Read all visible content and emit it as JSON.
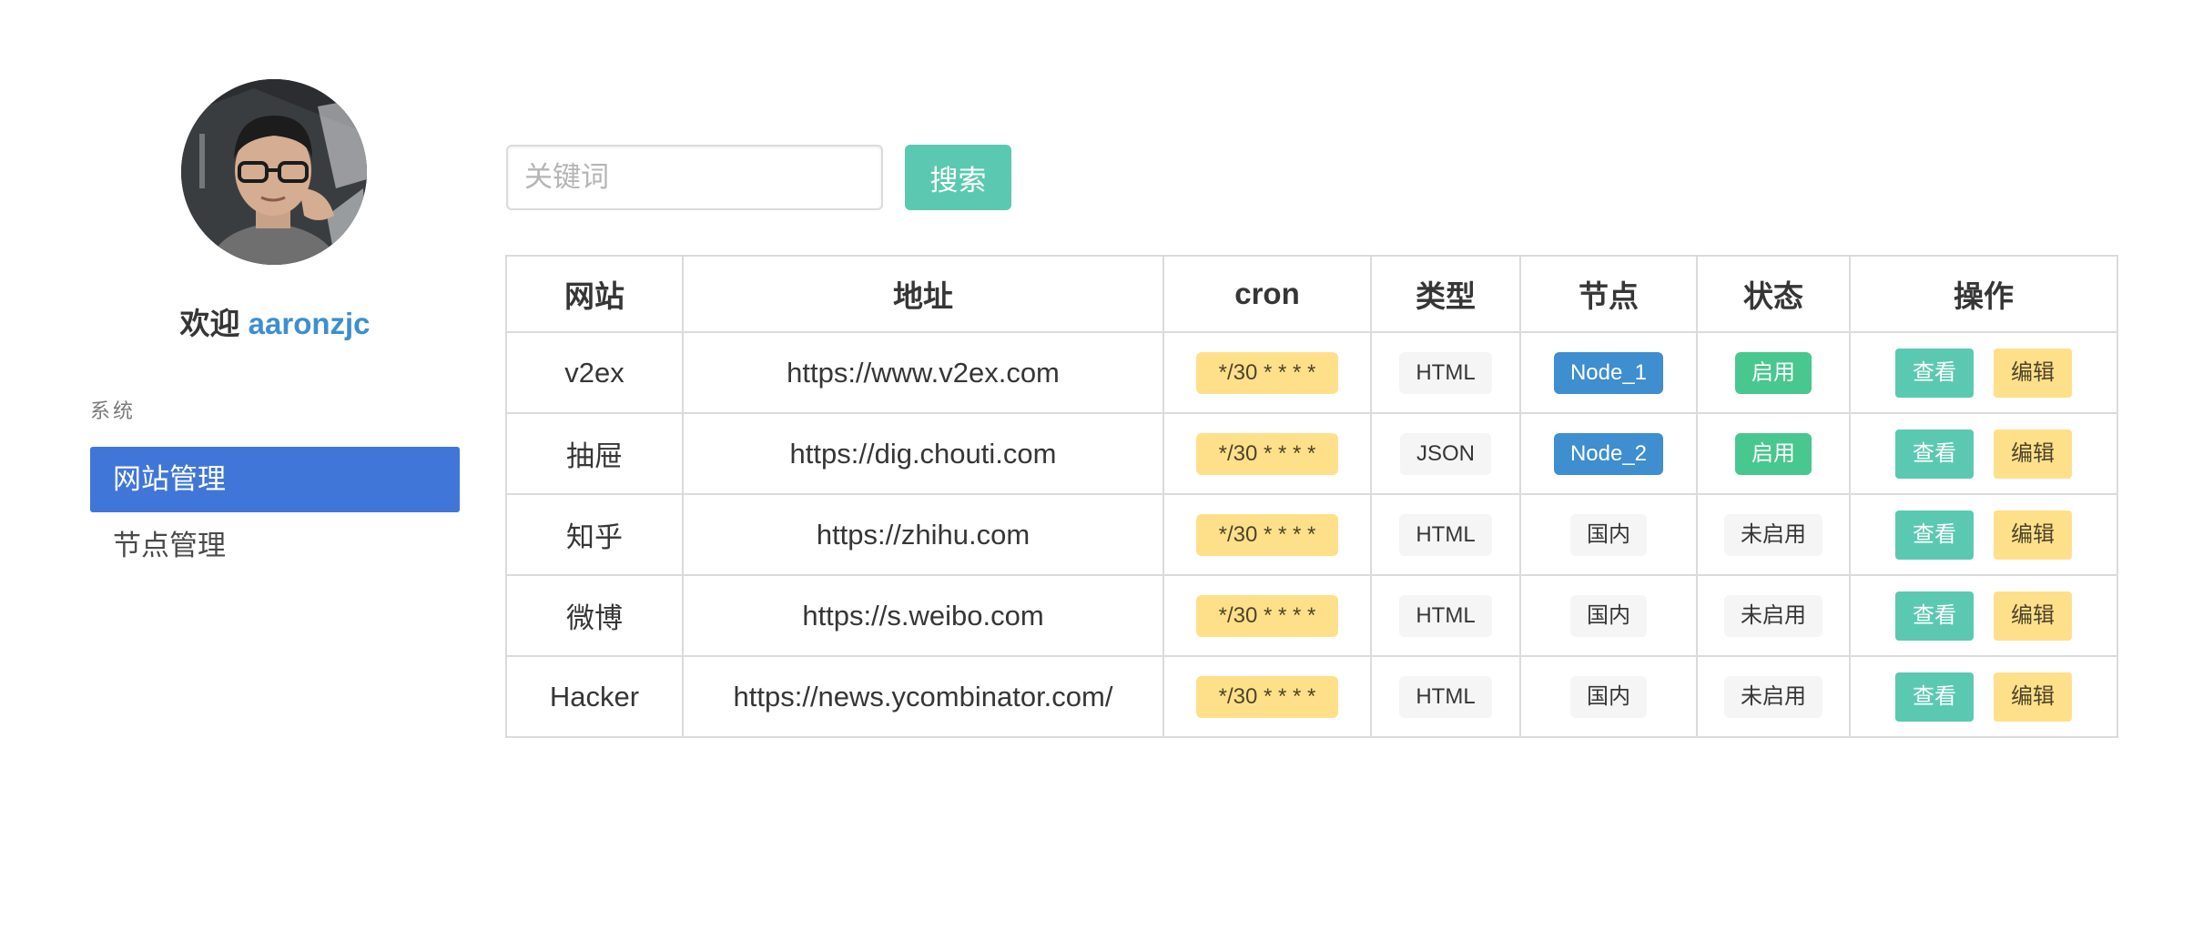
{
  "sidebar": {
    "welcome_prefix": "欢迎",
    "username": "aaronzjc",
    "menu_label": "系统",
    "items": [
      {
        "label": "网站管理",
        "active": true
      },
      {
        "label": "节点管理",
        "active": false
      }
    ]
  },
  "search": {
    "placeholder": "关键词",
    "value": "",
    "button_label": "搜索"
  },
  "table": {
    "headers": {
      "site": "网站",
      "url": "地址",
      "cron": "cron",
      "type": "类型",
      "node": "节点",
      "status": "状态",
      "ops": "操作"
    },
    "rows": [
      {
        "site": "v2ex",
        "url": "https://www.v2ex.com",
        "cron": "*/30 * * * *",
        "type": "HTML",
        "node": "Node_1",
        "status": "启用",
        "view": "查看",
        "edit": "编辑"
      },
      {
        "site": "抽屉",
        "url": "https://dig.chouti.com",
        "cron": "*/30 * * * *",
        "type": "JSON",
        "node": "Node_2",
        "status": "启用",
        "view": "查看",
        "edit": "编辑"
      },
      {
        "site": "知乎",
        "url": "https://zhihu.com",
        "cron": "*/30 * * * *",
        "type": "HTML",
        "node": "国内",
        "status": "未启用",
        "view": "查看",
        "edit": "编辑"
      },
      {
        "site": "微博",
        "url": "https://s.weibo.com",
        "cron": "*/30 * * * *",
        "type": "HTML",
        "node": "国内",
        "status": "未启用",
        "view": "查看",
        "edit": "编辑"
      },
      {
        "site": "Hacker",
        "url": "https://news.ycombinator.com/",
        "cron": "*/30 * * * *",
        "type": "HTML",
        "node": "国内",
        "status": "未启用",
        "view": "查看",
        "edit": "编辑"
      }
    ]
  },
  "colors": {
    "primary": "#4076d8",
    "teal": "#5bc9b1",
    "yellow": "#ffe08a",
    "blue": "#3e8ed0",
    "green": "#48c78e",
    "light": "#f5f5f5"
  }
}
